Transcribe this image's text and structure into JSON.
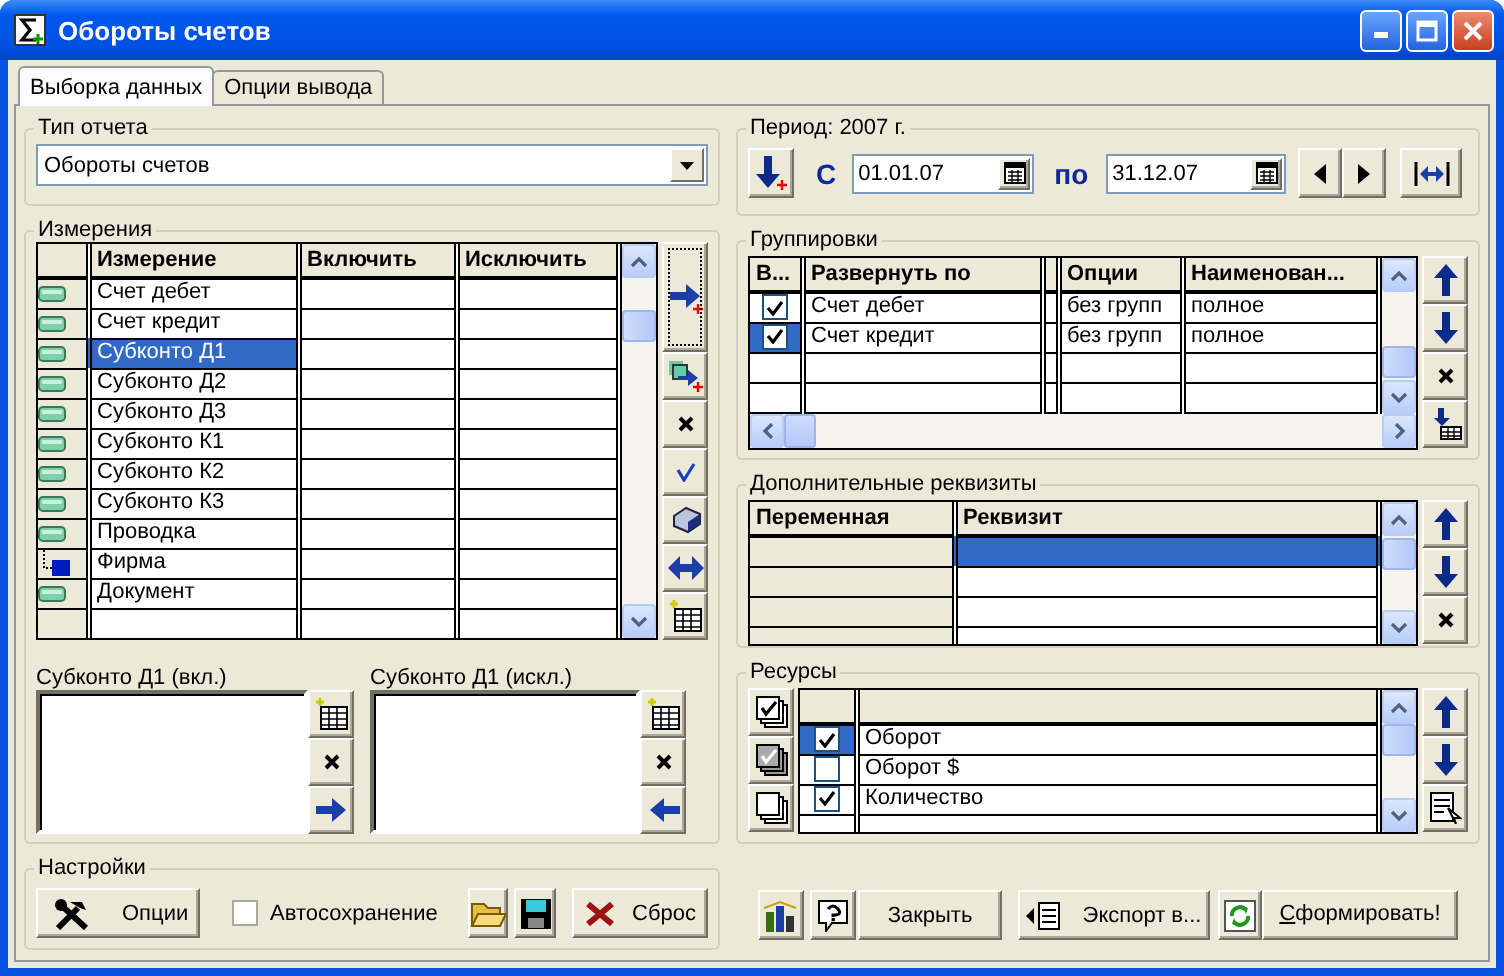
{
  "window": {
    "title": "Обороты счетов"
  },
  "tabs": [
    {
      "label": "Выборка данных",
      "selected": true
    },
    {
      "label": "Опции вывода",
      "selected": false
    }
  ],
  "report_type": {
    "label": "Тип отчета",
    "value": "Обороты счетов"
  },
  "dimensions": {
    "label": "Измерения",
    "columns": [
      "Измерение",
      "Включить",
      "Исключить"
    ],
    "rows": [
      {
        "name": "Счет дебет",
        "kind": "field",
        "selected": false
      },
      {
        "name": "Счет кредит",
        "kind": "field",
        "selected": false
      },
      {
        "name": "Субконто Д1",
        "kind": "field",
        "selected": true
      },
      {
        "name": "Субконто Д2",
        "kind": "field",
        "selected": false
      },
      {
        "name": "Субконто Д3",
        "kind": "field",
        "selected": false
      },
      {
        "name": "Субконто К1",
        "kind": "field",
        "selected": false
      },
      {
        "name": "Субконто К2",
        "kind": "field",
        "selected": false
      },
      {
        "name": "Субконто К3",
        "kind": "field",
        "selected": false
      },
      {
        "name": "Проводка",
        "kind": "field",
        "selected": false
      },
      {
        "name": "Фирма",
        "kind": "object",
        "selected": false
      },
      {
        "name": "Документ",
        "kind": "field",
        "selected": false
      }
    ]
  },
  "include_list": {
    "label": "Субконто Д1 (вкл.)"
  },
  "exclude_list": {
    "label": "Субконто Д1 (искл.)"
  },
  "settings": {
    "label": "Настройки",
    "options_button": "Опции",
    "autosave": {
      "label": "Автосохранение",
      "checked": false
    },
    "reset_button": "Сброс"
  },
  "period": {
    "label": "Период: 2007 г.",
    "from_label": "С",
    "from": "01.01.07",
    "to_label": "по",
    "to": "31.12.07"
  },
  "groupings": {
    "label": "Группировки",
    "columns": [
      "В...",
      "Развернуть по",
      "Опции",
      "Наименован..."
    ],
    "rows": [
      {
        "checked": true,
        "selected": false,
        "name": "Счет дебет",
        "options": "без групп",
        "naming": "полное"
      },
      {
        "checked": true,
        "selected": true,
        "name": "Счет кредит",
        "options": "без групп",
        "naming": "полное"
      }
    ]
  },
  "extra_attributes": {
    "label": "Дополнительные реквизиты",
    "columns": [
      "Переменная",
      "Реквизит"
    ],
    "rows": [
      {
        "selected": true
      },
      {
        "selected": false
      },
      {
        "selected": false
      },
      {
        "selected": false
      }
    ]
  },
  "resources": {
    "label": "Ресурсы",
    "rows": [
      {
        "name": "Оборот",
        "checked": true,
        "selected": true
      },
      {
        "name": "Оборот $",
        "checked": false,
        "selected": false
      },
      {
        "name": "Количество",
        "checked": true,
        "selected": false
      }
    ]
  },
  "footer": {
    "close_button": "Закрыть",
    "export_button": "Экспорт в...",
    "build_button": "Сформировать!"
  }
}
